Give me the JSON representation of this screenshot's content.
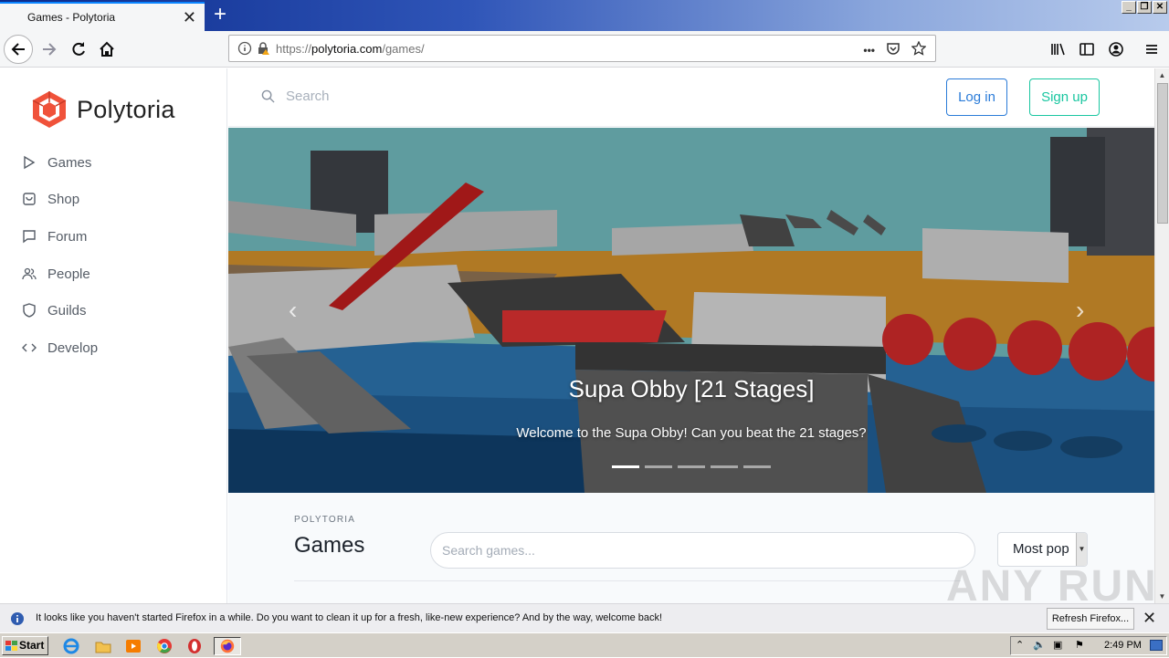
{
  "browser": {
    "tab_title": "Games - Polytoria",
    "url_prefix": "https://",
    "url_domain": "polytoria.com",
    "url_path": "/games/",
    "url_more": "•••"
  },
  "sidebar": {
    "brand": "Polytoria",
    "items": [
      {
        "label": "Games",
        "icon": "play-icon"
      },
      {
        "label": "Shop",
        "icon": "bag-icon"
      },
      {
        "label": "Forum",
        "icon": "chat-icon"
      },
      {
        "label": "People",
        "icon": "people-icon"
      },
      {
        "label": "Guilds",
        "icon": "shield-icon"
      },
      {
        "label": "Develop",
        "icon": "code-icon"
      }
    ]
  },
  "header": {
    "search_placeholder": "Search",
    "login": "Log in",
    "signup": "Sign up"
  },
  "hero": {
    "title": "Supa Obby [21 Stages]",
    "subtitle": "Welcome to the Supa Obby! Can you beat the 21 stages?",
    "slide_count": 5,
    "active_slide": 0
  },
  "games": {
    "eyebrow": "POLYTORIA",
    "title": "Games",
    "search_placeholder": "Search games...",
    "sort_selected": "Most pop"
  },
  "notification": {
    "message": "It looks like you haven't started Firefox in a while. Do you want to clean it up for a fresh, like-new experience? And by the way, welcome back!",
    "button": "Refresh Firefox..."
  },
  "taskbar": {
    "start": "Start",
    "clock": "2:49 PM"
  },
  "watermark": "ANY RUN",
  "colors": {
    "brand": "#f0523a",
    "login": "#2a7bd8",
    "signup": "#19c6a0"
  }
}
